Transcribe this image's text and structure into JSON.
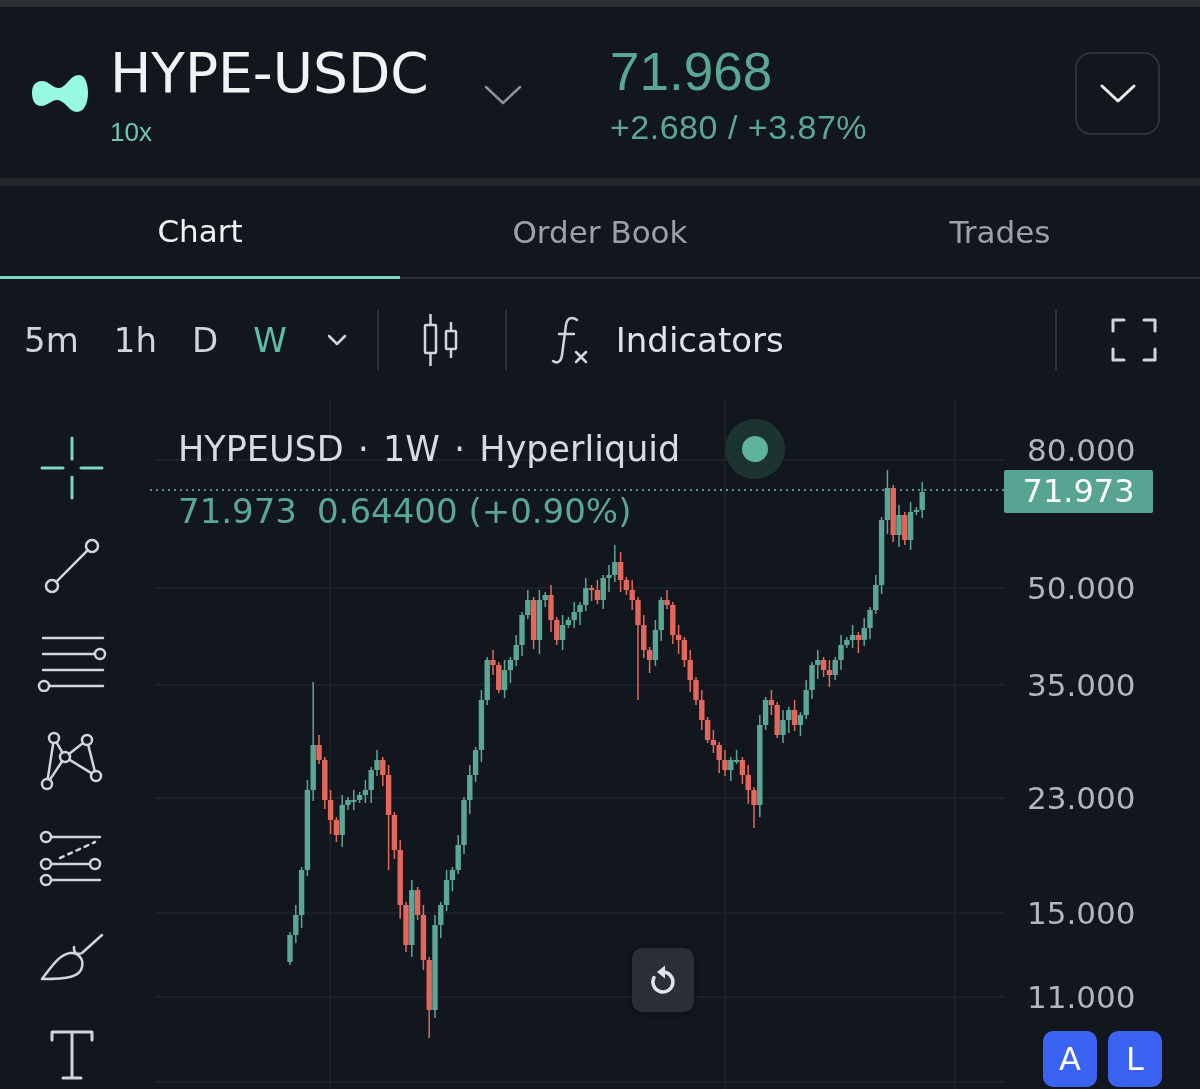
{
  "header": {
    "symbol": "HYPE-USDC",
    "leverage": "10x",
    "price": "71.968",
    "change": "+2.680 / +3.87%"
  },
  "tabs": [
    {
      "label": "Chart",
      "selected": true
    },
    {
      "label": "Order Book",
      "selected": false
    },
    {
      "label": "Trades",
      "selected": false
    }
  ],
  "toolbar": {
    "intervals": [
      {
        "label": "5m",
        "selected": false
      },
      {
        "label": "1h",
        "selected": false
      },
      {
        "label": "D",
        "selected": false
      },
      {
        "label": "W",
        "selected": true
      }
    ],
    "indicators": "Indicators"
  },
  "drawing_tools": [
    {
      "kind": "crosshair",
      "selected": true
    },
    {
      "kind": "line",
      "selected": false
    },
    {
      "kind": "channel",
      "selected": false
    },
    {
      "kind": "pattern",
      "selected": false
    },
    {
      "kind": "fibonacci",
      "selected": false
    },
    {
      "kind": "brush",
      "selected": false
    },
    {
      "kind": "text",
      "selected": false
    }
  ],
  "chart": {
    "legend": "HYPEUSD · 1W · Hyperliquid",
    "last": "71.973",
    "change": "0.64400 (+0.90%)",
    "price_tag": "71.973",
    "axis_labels": [
      "80.000",
      "50.000",
      "35.000",
      "23.000",
      "15.000",
      "11.000"
    ],
    "scale_buttons": [
      {
        "label": "A",
        "selected": true
      },
      {
        "label": "L",
        "selected": true
      }
    ]
  }
}
